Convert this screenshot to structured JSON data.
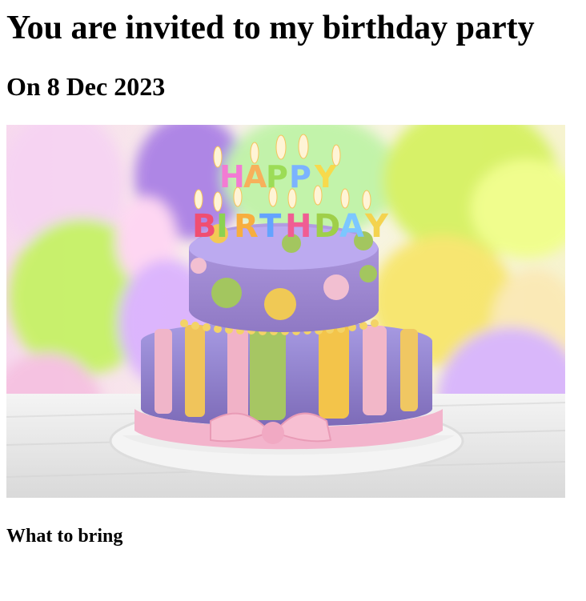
{
  "invite": {
    "title": "You are invited to my birthday party",
    "date": "On 8 Dec 2023",
    "section_heading": "What to bring"
  },
  "image": {
    "icon": "birthday-cake-photo",
    "candle_text": "HAPPY BIRTHDAY"
  },
  "colors": {
    "text": "#000000",
    "background": "#ffffff",
    "cake_purple": "#9b86c9",
    "cake_pink": "#f4b6c8",
    "cake_yellow": "#f2c94c",
    "cake_green": "#a7c76b"
  }
}
